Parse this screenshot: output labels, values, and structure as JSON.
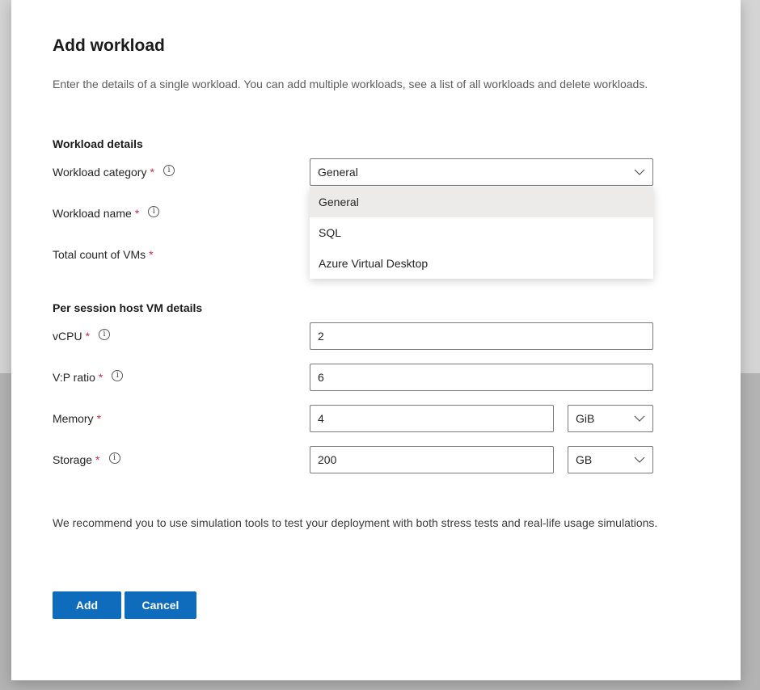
{
  "dialog": {
    "title": "Add workload",
    "description": "Enter the details of a single workload. You can add multiple workloads, see a list of all workloads and delete workloads."
  },
  "workload_details": {
    "section_title": "Workload details",
    "category_label": "Workload category",
    "category_value": "General",
    "name_label": "Workload name",
    "count_label": "Total count of VMs",
    "dropdown_options": [
      "General",
      "SQL",
      "Azure Virtual Desktop"
    ],
    "dropdown_selected": "General"
  },
  "vm_details": {
    "section_title": "Per session host VM details",
    "vcpu_label": "vCPU",
    "vcpu_value": "2",
    "vp_ratio_label": "V:P ratio",
    "vp_ratio_value": "6",
    "memory_label": "Memory",
    "memory_value": "4",
    "memory_unit": "GiB",
    "storage_label": "Storage",
    "storage_value": "200",
    "storage_unit": "GB"
  },
  "required_marker": "*",
  "info_icon": "i",
  "note": "We recommend you to use simulation tools to test your deployment with both stress tests and real-life usage simulations.",
  "buttons": {
    "add": "Add",
    "cancel": "Cancel"
  },
  "colors": {
    "primary": "#0f6cbd",
    "required": "#c4314b",
    "selected_option": "#edebe9"
  }
}
